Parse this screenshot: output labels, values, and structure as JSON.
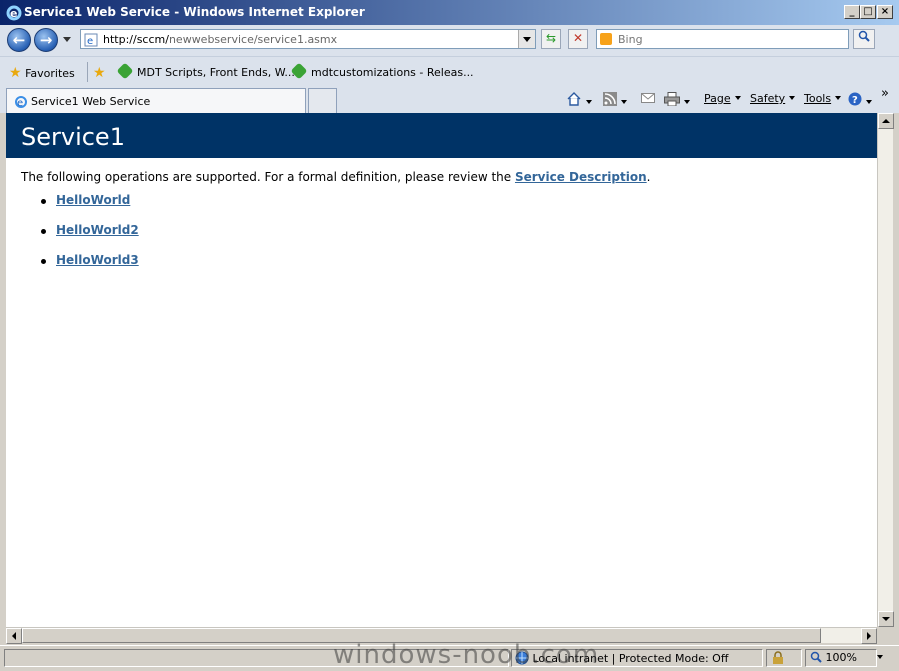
{
  "window": {
    "title": "Service1 Web Service - Windows Internet Explorer"
  },
  "address": {
    "url_host": "http://sccm/",
    "url_path": "newwebservice/service1.asmx"
  },
  "search": {
    "placeholder": "Bing"
  },
  "favorites": {
    "label": "Favorites",
    "items": [
      {
        "label": "MDT Scripts, Front Ends, W..."
      },
      {
        "label": "mdtcustomizations - Releas..."
      }
    ]
  },
  "tab": {
    "label": "Service1 Web Service"
  },
  "commandbar": {
    "page": "Page",
    "safety": "Safety",
    "tools": "Tools"
  },
  "page": {
    "heading": "Service1",
    "intro_text": "The following operations are supported. For a formal definition, please review the ",
    "intro_link": "Service Description",
    "intro_end": ".",
    "operations": [
      {
        "label": "HelloWorld"
      },
      {
        "label": "HelloWorld2"
      },
      {
        "label": "HelloWorld3"
      }
    ]
  },
  "status": {
    "zone": "Local intranet | Protected Mode: Off",
    "zoom": "100%"
  },
  "watermark": "windows-noob.com"
}
